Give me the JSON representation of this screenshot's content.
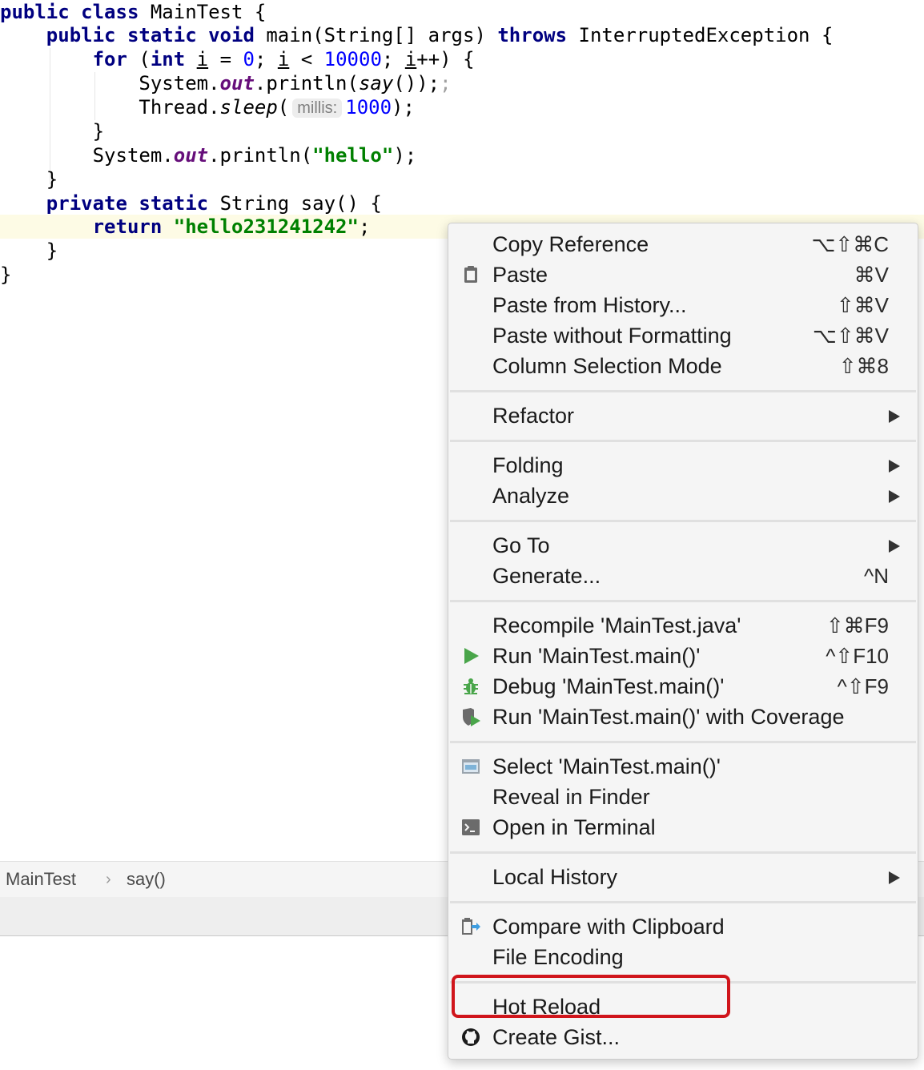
{
  "editor": {
    "class_decl": {
      "k1": "public",
      "k2": "class",
      "name": "MainTest {"
    },
    "main_decl": {
      "k1": "public",
      "k2": "static",
      "k3": "void",
      "sig": "main(String[] args)",
      "k4": "throws",
      "rest": "InterruptedException {"
    },
    "for_line": {
      "k1": "for",
      "p1": "(",
      "k2": "int",
      "v1": "i",
      "eq": "=",
      "n1": "0",
      "semi1": ";",
      "v2": "i",
      "lt": "<",
      "n2": "10000",
      "semi2": ";",
      "v3": "i",
      "inc": "++) {"
    },
    "println_line": {
      "obj": "System.",
      "field": "out",
      "call": ".println(",
      "say": "say",
      "tail": "());",
      "extra": ";"
    },
    "sleep_line": {
      "obj": "Thread.",
      "method": "sleep",
      "open": "(",
      "hint": "millis:",
      "num": "1000",
      "close": ");"
    },
    "close_for": "}",
    "hello_line": {
      "obj": "System.",
      "field": "out",
      "call": ".println(",
      "str": "\"hello\"",
      "close": ");"
    },
    "close_main": "}",
    "say_decl": {
      "k1": "private",
      "k2": "static",
      "rest": "String say() {"
    },
    "return_line": {
      "k1": "return",
      "str": "\"hello231241242\"",
      "semi": ";"
    },
    "close_say": "}",
    "close_class": "}"
  },
  "breadcrumb": {
    "items": [
      "MainTest",
      "say()"
    ],
    "separator": "›"
  },
  "context_menu": {
    "items": {
      "copy_reference": {
        "label": "Copy Reference",
        "shortcut": "⌥⇧⌘C"
      },
      "paste": {
        "label": "Paste",
        "shortcut": "⌘V",
        "icon": "clipboard-icon"
      },
      "paste_history": {
        "label": "Paste from History...",
        "shortcut": "⇧⌘V"
      },
      "paste_no_format": {
        "label": "Paste without Formatting",
        "shortcut": "⌥⇧⌘V"
      },
      "column_mode": {
        "label": "Column Selection Mode",
        "shortcut": "⇧⌘8"
      },
      "refactor": {
        "label": "Refactor"
      },
      "folding": {
        "label": "Folding"
      },
      "analyze": {
        "label": "Analyze"
      },
      "go_to": {
        "label": "Go To"
      },
      "generate": {
        "label": "Generate...",
        "shortcut": "^N"
      },
      "recompile": {
        "label": "Recompile 'MainTest.java'",
        "shortcut": "⇧⌘F9"
      },
      "run": {
        "label": "Run 'MainTest.main()'",
        "shortcut": "^⇧F10",
        "icon": "run-icon"
      },
      "debug": {
        "label": "Debug 'MainTest.main()'",
        "shortcut": "^⇧F9",
        "icon": "debug-icon"
      },
      "run_coverage": {
        "label": "Run 'MainTest.main()' with Coverage",
        "icon": "coverage-icon"
      },
      "select": {
        "label": "Select 'MainTest.main()'",
        "icon": "select-icon"
      },
      "reveal_finder": {
        "label": "Reveal in Finder"
      },
      "open_terminal": {
        "label": "Open in Terminal",
        "icon": "terminal-icon"
      },
      "local_history": {
        "label": "Local History"
      },
      "compare_clipboard": {
        "label": "Compare with Clipboard",
        "icon": "compare-icon"
      },
      "file_encoding": {
        "label": "File Encoding"
      },
      "hot_reload": {
        "label": "Hot Reload"
      },
      "create_gist": {
        "label": "Create Gist...",
        "icon": "github-icon"
      }
    }
  },
  "colors": {
    "keyword": "#000080",
    "number": "#0000ff",
    "string": "#008000",
    "field": "#660e7a",
    "highlight_border": "#d0151b",
    "run_green": "#49a54a"
  }
}
